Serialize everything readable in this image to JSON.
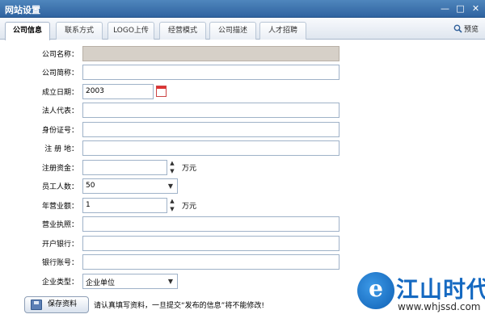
{
  "window": {
    "title": "网站设置",
    "controls": [
      "—",
      "□",
      "✕"
    ]
  },
  "tabs": [
    {
      "label": "公司信息",
      "active": true
    },
    {
      "label": "联系方式",
      "active": false
    },
    {
      "label": "LOGO上传",
      "active": false
    },
    {
      "label": "经营模式",
      "active": false
    },
    {
      "label": "公司描述",
      "active": false
    },
    {
      "label": "人才招聘",
      "active": false
    }
  ],
  "preview": {
    "label": "预览",
    "icon": "magnifier-icon"
  },
  "form": {
    "company_name": {
      "label": "公司名称：",
      "value": "",
      "disabled": true
    },
    "company_short": {
      "label": "公司简称：",
      "value": ""
    },
    "founded_date": {
      "label": "成立日期：",
      "value": "2003",
      "icon": "calendar-icon"
    },
    "legal_rep": {
      "label": "法人代表：",
      "value": ""
    },
    "id_number": {
      "label": "身份证号：",
      "value": ""
    },
    "reg_address": {
      "label": "注 册 地：",
      "value": ""
    },
    "reg_capital": {
      "label": "注册资金：",
      "value": "",
      "unit": "万元"
    },
    "employees": {
      "label": "员工人数：",
      "value": "50"
    },
    "annual_revenue": {
      "label": "年营业额：",
      "value": "1",
      "unit": "万元"
    },
    "business_license": {
      "label": "营业执照：",
      "value": ""
    },
    "bank": {
      "label": "开户银行：",
      "value": ""
    },
    "bank_account": {
      "label": "银行账号：",
      "value": ""
    },
    "company_type": {
      "label": "企业类型：",
      "value": "企业单位"
    }
  },
  "save_button": {
    "label": "保存资料"
  },
  "notice": "请认真填写资料，一旦提交“发布的信息”将不能修改!",
  "watermark": {
    "logo_letter": "e",
    "name": "江山时代",
    "url": "www.whjssd.com"
  },
  "colors": {
    "titlebar": "#3a72ae",
    "accent": "#1569c1",
    "disabled_field": "#d6d0c8"
  }
}
